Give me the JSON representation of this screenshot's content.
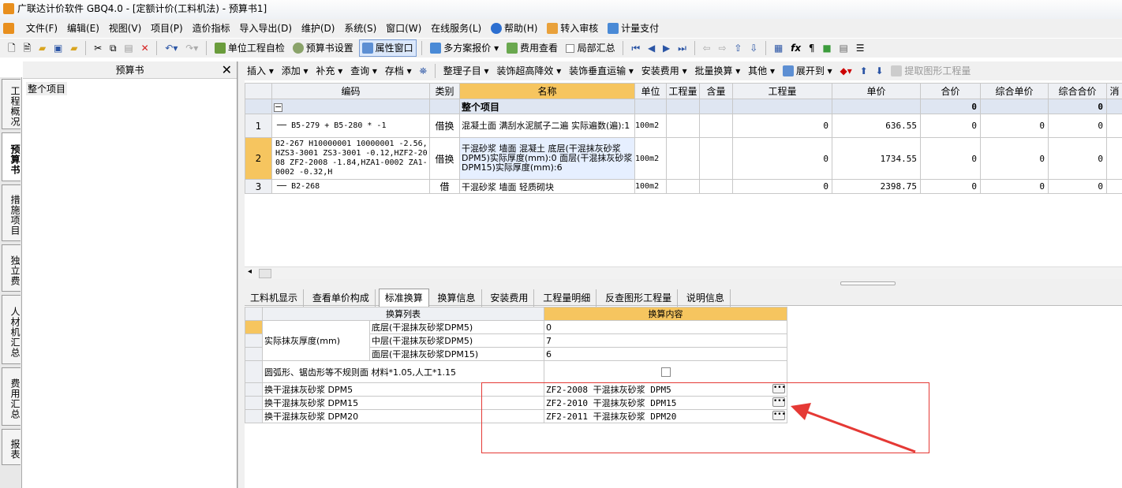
{
  "window": {
    "title": "广联达计价软件 GBQ4.0 - [定额计价(工料机法) - 预算书1]"
  },
  "menu": [
    "文件(F)",
    "编辑(E)",
    "视图(V)",
    "项目(P)",
    "造价指标",
    "导入导出(D)",
    "维护(D)",
    "系统(S)",
    "窗口(W)",
    "在线服务(L)",
    "帮助(H)",
    "转入审核",
    "计量支付"
  ],
  "toolbar1": {
    "check": "单位工程自检",
    "settings": "预算书设置",
    "property_window": "属性窗口",
    "multi_quote": "多方案报价",
    "fee_view": "费用查看",
    "partial_sum": "局部汇总"
  },
  "toolbar2": {
    "insert": "插入",
    "add": "添加",
    "supplement": "补充",
    "query": "查询",
    "archive": "存档",
    "organize": "整理子目",
    "decor_high": "装饰超高降效",
    "decor_vert": "装饰垂直运输",
    "install_fee": "安装费用",
    "batch_convert": "批量换算",
    "other": "其他",
    "expand": "展开到",
    "extract": "提取图形工程量"
  },
  "left_tabs": [
    "工程概况",
    "预算书",
    "措施项目",
    "独立费",
    "人材机汇总",
    "费用汇总",
    "报表"
  ],
  "left_panel": {
    "title": "预算书",
    "close": "✕",
    "item": "整个项目"
  },
  "grid": {
    "headers": [
      "编码",
      "类别",
      "名称",
      "单位",
      "工程量",
      "含量",
      "工程量",
      "单价",
      "合价",
      "综合单价",
      "综合合价",
      "消"
    ],
    "project_row": {
      "toggle": "−",
      "name": "整个项目",
      "total1": "0",
      "total2": "0"
    },
    "rows": [
      {
        "no": "1",
        "code": "B5-279 + B5-280 * -1",
        "type": "借换",
        "name": "混凝土面 满刮水泥腻子二遍 实际遍数(遍):1",
        "unit": "100m2",
        "qty": "0",
        "price": "636.55",
        "total": "0",
        "unit_total": "0",
        "comp_total": "0"
      },
      {
        "no": "2",
        "code": "B2-267 H10000001 10000001 -2.56,HZS3-3001 ZS3-3001 -0.12,HZF2-2008 ZF2-2008 -1.84,HZA1-0002 ZA1-0002 -0.32,H",
        "type": "借换",
        "name": "干混砂浆 墙面 混凝土 底层(干混抹灰砂浆DPM5)实际厚度(mm):0 面层(干混抹灰砂浆DPM15)实际厚度(mm):6",
        "unit": "100m2",
        "qty": "0",
        "price": "1734.55",
        "total": "0",
        "unit_total": "0",
        "comp_total": "0"
      },
      {
        "no": "3",
        "code": "B2-268",
        "type": "借",
        "name": "干混砂浆 墙面 轻质砌块",
        "unit": "100m2",
        "qty": "0",
        "price": "2398.75",
        "total": "0",
        "unit_total": "0",
        "comp_total": "0"
      }
    ]
  },
  "bottom_tabs": [
    "工料机显示",
    "查看单价构成",
    "标准换算",
    "换算信息",
    "安装费用",
    "工程量明细",
    "反查图形工程量",
    "说明信息"
  ],
  "conversion": {
    "header_list": "换算列表",
    "header_content": "换算内容",
    "thickness_label": "实际抹灰厚度(mm)",
    "layers": [
      {
        "name": "底层(干混抹灰砂浆DPM5)",
        "value": "0"
      },
      {
        "name": "中层(干混抹灰砂浆DPM5)",
        "value": "7"
      },
      {
        "name": "面层(干混抹灰砂浆DPM15)",
        "value": "6"
      }
    ],
    "arc_label": "圆弧形、锯齿形等不规则面 材料*1.05,人工*1.15",
    "replacements": [
      {
        "label": "换干混抹灰砂浆 DPM5",
        "value": "ZF2-2008  干混抹灰砂浆 DPM5"
      },
      {
        "label": "换干混抹灰砂浆 DPM15",
        "value": "ZF2-2010  干混抹灰砂浆 DPM15"
      },
      {
        "label": "换干混抹灰砂浆 DPM20",
        "value": "ZF2-2011  干混抹灰砂浆 DPM20"
      }
    ],
    "dots": "•••"
  },
  "colors": {
    "highlight": "#f6c55f",
    "annotation": "#e53935"
  }
}
